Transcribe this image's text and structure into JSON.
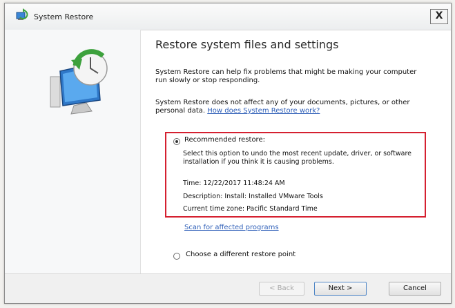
{
  "window": {
    "title": "System Restore",
    "close_label": "X"
  },
  "content": {
    "heading": "Restore system files and settings",
    "para1": "System Restore can help fix problems that might be making your computer run slowly or stop responding.",
    "para2_text": "System Restore does not affect any of your documents, pictures, or other personal data.",
    "para2_link": "How does System Restore work?",
    "recommended": {
      "label": "Recommended restore:",
      "selected": true,
      "description": "Select this option to undo the most recent update, driver, or software installation if you think it is causing problems.",
      "time": "Time: 12/22/2017 11:48:24 AM",
      "description_line": "Description: Install: Installed VMware Tools",
      "timezone": "Current time zone: Pacific Standard Time"
    },
    "scan_link": "Scan for affected programs",
    "choose_label": "Choose a different restore point"
  },
  "footer": {
    "back": "< Back",
    "next": "Next >",
    "cancel": "Cancel"
  },
  "colors": {
    "highlight_border": "#d52030",
    "link": "#2e5fb8"
  },
  "icons": [
    "system-restore-icon",
    "system-restore-illustration"
  ]
}
